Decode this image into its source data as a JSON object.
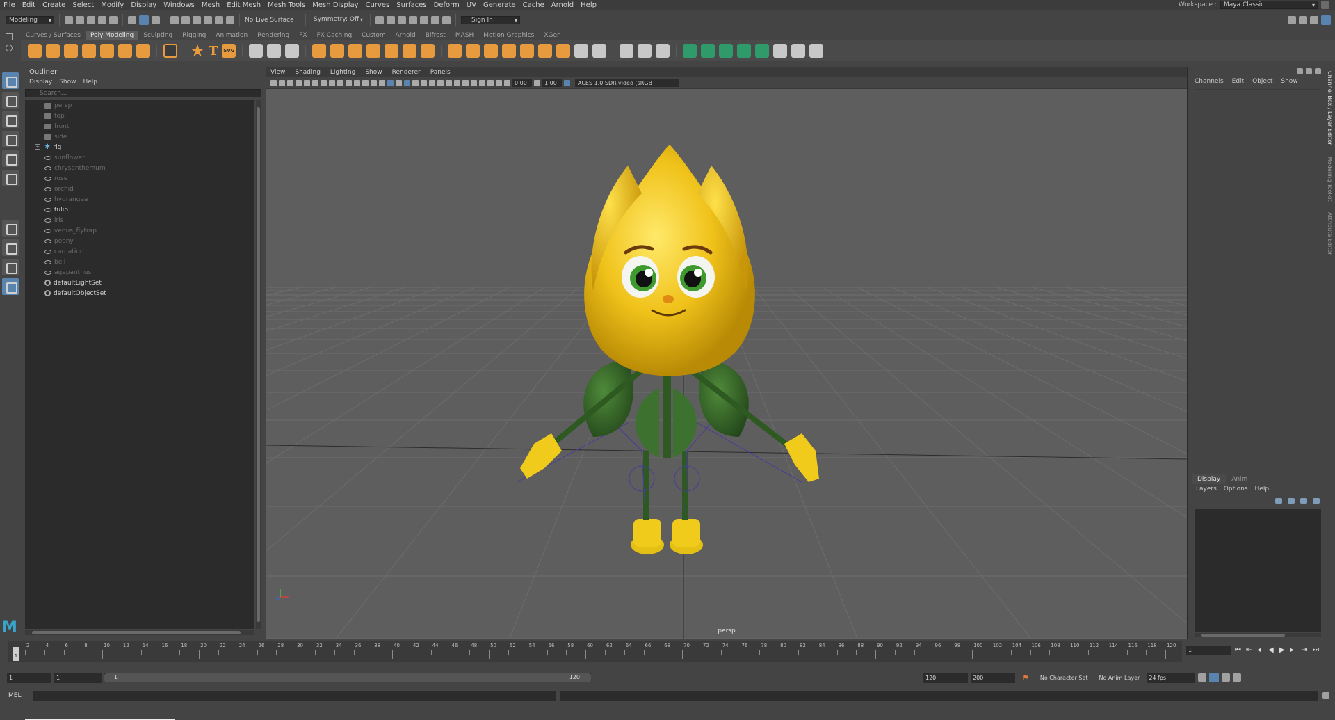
{
  "menubar": {
    "items": [
      "File",
      "Edit",
      "Create",
      "Select",
      "Modify",
      "Display",
      "Windows",
      "Mesh",
      "Edit Mesh",
      "Mesh Tools",
      "Mesh Display",
      "Curves",
      "Surfaces",
      "Deform",
      "UV",
      "Generate",
      "Cache",
      "Arnold",
      "Help"
    ],
    "workspace_label": "Workspace :",
    "workspace_value": "Maya Classic"
  },
  "statusline": {
    "mode": "Modeling",
    "live_surface": "No Live Surface",
    "symmetry": "Symmetry: Off",
    "sign_in": "Sign In"
  },
  "shelf": {
    "tabs": [
      "Curves / Surfaces",
      "Poly Modeling",
      "Sculpting",
      "Rigging",
      "Animation",
      "Rendering",
      "FX",
      "FX Caching",
      "Custom",
      "Arnold",
      "Bifrost",
      "MASH",
      "Motion Graphics",
      "XGen"
    ],
    "active_tab": "Poly Modeling",
    "svg_label": "SVG"
  },
  "outliner": {
    "title": "Outliner",
    "menu": [
      "Display",
      "Show",
      "Help"
    ],
    "search_placeholder": "Search...",
    "items": [
      {
        "label": "persp",
        "kind": "camera",
        "dim": true
      },
      {
        "label": "top",
        "kind": "camera",
        "dim": true
      },
      {
        "label": "front",
        "kind": "camera",
        "dim": true
      },
      {
        "label": "side",
        "kind": "camera",
        "dim": true
      },
      {
        "label": "rig",
        "kind": "joint",
        "dim": false,
        "expandable": true
      },
      {
        "label": "sunflower",
        "kind": "mesh",
        "dim": true
      },
      {
        "label": "chrysanthemum",
        "kind": "mesh",
        "dim": true
      },
      {
        "label": "rose",
        "kind": "mesh",
        "dim": true
      },
      {
        "label": "orchid",
        "kind": "mesh",
        "dim": true
      },
      {
        "label": "hydrangea",
        "kind": "mesh",
        "dim": true
      },
      {
        "label": "tulip",
        "kind": "mesh",
        "dim": false
      },
      {
        "label": "iris",
        "kind": "mesh",
        "dim": true
      },
      {
        "label": "venus_flytrap",
        "kind": "mesh",
        "dim": true
      },
      {
        "label": "peony",
        "kind": "mesh",
        "dim": true
      },
      {
        "label": "carnation",
        "kind": "mesh",
        "dim": true
      },
      {
        "label": "bell",
        "kind": "mesh",
        "dim": true
      },
      {
        "label": "agapanthus",
        "kind": "mesh",
        "dim": true
      },
      {
        "label": "defaultLightSet",
        "kind": "set",
        "dim": false
      },
      {
        "label": "defaultObjectSet",
        "kind": "set",
        "dim": false
      }
    ]
  },
  "viewport": {
    "menu": [
      "View",
      "Shading",
      "Lighting",
      "Show",
      "Renderer",
      "Panels"
    ],
    "exposure": "0.00",
    "gamma": "1.00",
    "color_space": "ACES 1.0 SDR-video (sRGB",
    "camera_label": "persp"
  },
  "channelbox": {
    "menu": [
      "Channels",
      "Edit",
      "Object",
      "Show"
    ]
  },
  "layereditor": {
    "tabs": [
      "Display",
      "Anim"
    ],
    "active_tab": "Display",
    "menu": [
      "Layers",
      "Options",
      "Help"
    ]
  },
  "sidetabs": [
    "Channel Box / Layer Editor",
    "Modeling Toolkit",
    "Attribute Editor"
  ],
  "timeslider": {
    "ticks": [
      1,
      2,
      4,
      6,
      8,
      10,
      12,
      14,
      16,
      18,
      20,
      22,
      24,
      26,
      28,
      30,
      32,
      34,
      36,
      38,
      40,
      42,
      44,
      46,
      48,
      50,
      52,
      54,
      56,
      58,
      60,
      62,
      64,
      66,
      68,
      70,
      72,
      74,
      76,
      78,
      80,
      82,
      84,
      86,
      88,
      90,
      92,
      94,
      96,
      98,
      100,
      102,
      104,
      106,
      108,
      110,
      112,
      114,
      116,
      118,
      120
    ],
    "current_frame": "1",
    "current_frame_marker": "1"
  },
  "rangeslider": {
    "start": "1",
    "playback_start": "1",
    "range_start": "1",
    "range_end": "120",
    "playback_end": "120",
    "end": "200",
    "character_set": "No Character Set",
    "anim_layer": "No Anim Layer",
    "fps": "24 fps"
  },
  "cmdline": {
    "lang": "MEL"
  },
  "colors": {
    "tulip_yellow": "#f0c21a",
    "stem_green": "#2e5a22",
    "shelf_orange": "#e79a3e",
    "highlight_blue": "#5a84b0"
  }
}
